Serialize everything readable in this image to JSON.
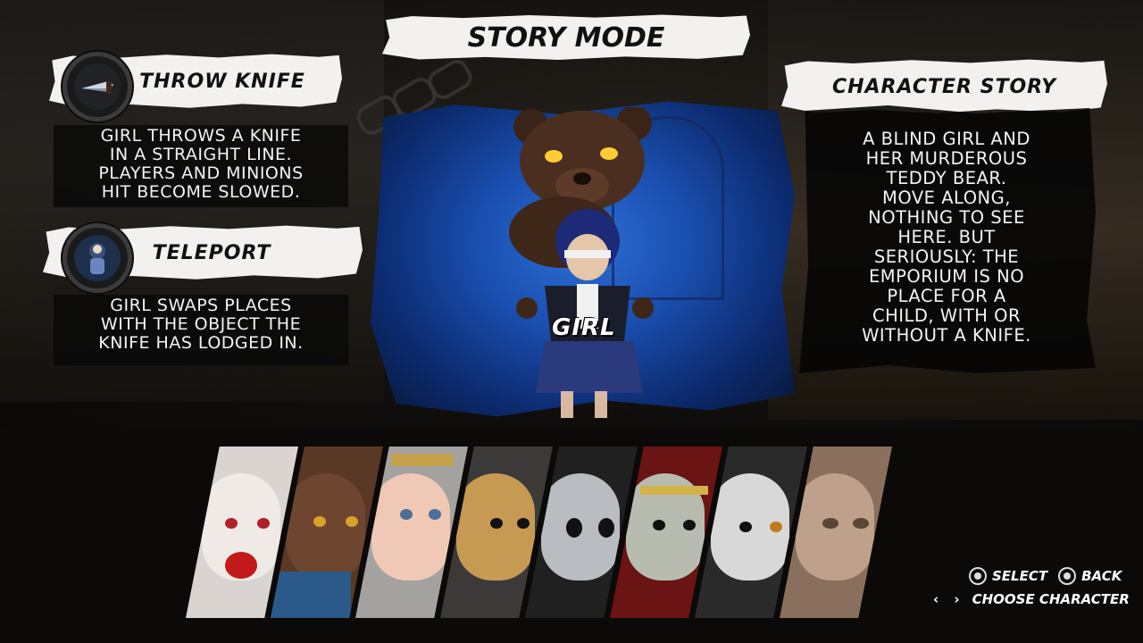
{
  "title": "Story Mode",
  "abilities": [
    {
      "name": "Throw Knife",
      "icon": "knife-icon",
      "description_lines": [
        "GIRL THROWS A KNIFE",
        "IN A STRAIGHT LINE.",
        "PLAYERS AND MINIONS",
        "HIT BECOME SLOWED."
      ]
    },
    {
      "name": "Teleport",
      "icon": "teleport-icon",
      "description_lines": [
        "GIRL SWAPS PLACES",
        "WITH THE OBJECT THE",
        "KNIFE HAS LODGED IN."
      ]
    }
  ],
  "character_story": {
    "heading": "Character Story",
    "lines": [
      "A BLIND GIRL AND",
      "HER MURDEROUS",
      "TEDDY BEAR.",
      "MOVE ALONG,",
      "NOTHING TO SEE",
      "HERE. BUT",
      "SERIOUSLY: THE",
      "EMPORIUM IS NO",
      "PLACE FOR A",
      "CHILD, WITH OR",
      "WITHOUT A KNIFE."
    ]
  },
  "character": {
    "name": "GIRL"
  },
  "roster": [
    {
      "id": "clown",
      "colors": {
        "bg": "#d9d4cf",
        "face": "#efeae6",
        "accent": "#c21a1a"
      }
    },
    {
      "id": "bear",
      "colors": {
        "bg": "#5a3826",
        "face": "#6e4630",
        "accent": "#2b5a8a"
      }
    },
    {
      "id": "doll",
      "colors": {
        "bg": "#a3a29f",
        "face": "#efc9b5",
        "accent": "#c4a14a"
      }
    },
    {
      "id": "gold-mask",
      "colors": {
        "bg": "#3c3a38",
        "face": "#c69a52",
        "accent": "#8a5f2a"
      }
    },
    {
      "id": "sack-mask",
      "colors": {
        "bg": "#202020",
        "face": "#b9bcc1",
        "accent": "#4a4a4a"
      }
    },
    {
      "id": "greek-mask",
      "colors": {
        "bg": "#6a1414",
        "face": "#b7bbb0",
        "accent": "#d4b24a"
      }
    },
    {
      "id": "pale-face",
      "colors": {
        "bg": "#2a2a2a",
        "face": "#d8d8d8",
        "accent": "#8a2a2a"
      }
    },
    {
      "id": "old-man",
      "colors": {
        "bg": "#8a6f5c",
        "face": "#bfa08a",
        "accent": "#5a4636"
      }
    }
  ],
  "controls": {
    "select_label": "Select",
    "back_label": "Back",
    "choose_label": "Choose Character",
    "choose_glyph": "‹ ›"
  }
}
